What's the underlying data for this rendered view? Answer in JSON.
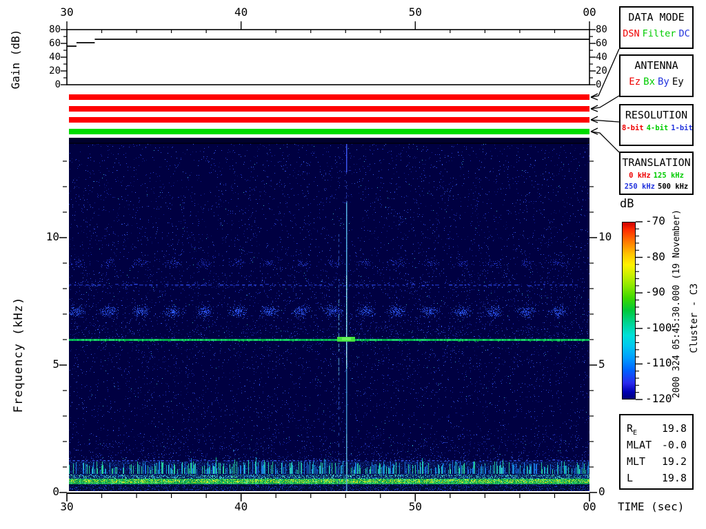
{
  "gain_panel": {
    "ylabel": "Gain (dB)",
    "yticks": [
      {
        "label": "80",
        "v": 80
      },
      {
        "label": "60",
        "v": 60
      },
      {
        "label": "40",
        "v": 40
      },
      {
        "label": "20",
        "v": 20
      },
      {
        "label": "0",
        "v": 0
      }
    ]
  },
  "time_axis": {
    "label": "TIME (sec)",
    "ticks": [
      {
        "label": "30",
        "t": 30
      },
      {
        "label": "40",
        "t": 40
      },
      {
        "label": "50",
        "t": 50
      },
      {
        "label": "00",
        "t": 60
      }
    ]
  },
  "freq_axis": {
    "label": "Frequency (kHz)",
    "ticks": [
      {
        "label": "10",
        "f": 10
      },
      {
        "label": "5",
        "f": 5
      },
      {
        "label": "0",
        "f": 0
      }
    ]
  },
  "status_bars": [
    {
      "name": "data-mode-bar",
      "color": "#ff0000"
    },
    {
      "name": "antenna-bar",
      "color": "#ff0000"
    },
    {
      "name": "resolution-bar",
      "color": "#ff0000"
    },
    {
      "name": "translation-bar",
      "color": "#00dd00"
    }
  ],
  "panels": [
    {
      "title": "DATA MODE",
      "rows": [
        [
          {
            "label": "DSN",
            "color": "#ee0000"
          },
          {
            "label": "Filter",
            "color": "#00cc00"
          },
          {
            "label": "DC",
            "color": "#2233dd"
          }
        ]
      ]
    },
    {
      "title": "ANTENNA",
      "rows": [
        [
          {
            "label": "Ez",
            "color": "#ee0000"
          },
          {
            "label": "Bx",
            "color": "#00cc00"
          },
          {
            "label": "By",
            "color": "#2233dd"
          },
          {
            "label": "Ey",
            "color": "#000000"
          }
        ]
      ]
    },
    {
      "title": "RESOLUTION",
      "rows": [
        [
          {
            "label": "8-bit",
            "color": "#ee0000"
          },
          {
            "label": "4-bit",
            "color": "#00cc00"
          },
          {
            "label": "1-bit",
            "color": "#2233dd"
          }
        ]
      ]
    },
    {
      "title": "TRANSLATION",
      "rows": [
        [
          {
            "label": "0 kHz",
            "color": "#ee0000"
          },
          {
            "label": "125 kHz",
            "color": "#00cc00"
          }
        ],
        [
          {
            "label": "250 kHz",
            "color": "#2233dd"
          },
          {
            "label": "500 kHz",
            "color": "#000000"
          }
        ]
      ]
    }
  ],
  "colorbar": {
    "title": "dB",
    "ticks": [
      {
        "label": "-70",
        "v": -70
      },
      {
        "label": "-80",
        "v": -80
      },
      {
        "label": "-90",
        "v": -90
      },
      {
        "label": "-100",
        "v": -100
      },
      {
        "label": "-110",
        "v": -110
      },
      {
        "label": "-120",
        "v": -120
      }
    ],
    "gradient": [
      "#cc0000 0%",
      "#ff2a00 4%",
      "#ff7a00 11%",
      "#ffc400 18%",
      "#fff200 24%",
      "#c8f000 30%",
      "#8ce800 36%",
      "#3cd800 43%",
      "#00c83c 50%",
      "#00d492 57%",
      "#00e0d8 64%",
      "#00c8f0 70%",
      "#009cff 77%",
      "#0060ff 84%",
      "#2a2aee 91%",
      "#0000b4 96%",
      "#000078 100%"
    ]
  },
  "side_text": {
    "timestamp": "2000 324 05:45:30.000 (19 November)",
    "spacecraft": "Cluster - C3"
  },
  "info_box": {
    "rows": [
      {
        "label": "R",
        "sub": "E",
        "value": "19.8"
      },
      {
        "label": "MLAT",
        "sub": "",
        "value": "-0.0"
      },
      {
        "label": "MLT",
        "sub": "",
        "value": "19.2"
      },
      {
        "label": "L",
        "sub": "",
        "value": "19.8"
      }
    ]
  },
  "chart_data": [
    {
      "type": "line",
      "title": "Receiver gain steps",
      "ylabel": "Gain (dB)",
      "ylim": [
        0,
        80
      ],
      "yticks": [
        0,
        20,
        40,
        60,
        80
      ],
      "x_range_sec": [
        30,
        60
      ],
      "segments": [
        {
          "t": [
            30.0,
            30.55
          ],
          "db": 56
        },
        {
          "t": [
            30.55,
            31.6
          ],
          "db": 61
        },
        {
          "t": [
            31.6,
            60.0
          ],
          "db": 66
        }
      ]
    },
    {
      "type": "heatmap",
      "title": "WBD wideband spectrogram",
      "xlabel": "TIME (sec)",
      "ylabel": "Frequency (kHz)",
      "x_range_sec": [
        30,
        60
      ],
      "x_tick_labels": [
        "30",
        "40",
        "50",
        "00"
      ],
      "y_range_khz": [
        0,
        13.8
      ],
      "colorbar_db": [
        -70,
        -120
      ],
      "background_db": -119,
      "features": [
        {
          "type": "horizontal_line",
          "freq_khz": 6.0,
          "level_db": -95,
          "desc": "continuous narrowband emission across full interval"
        },
        {
          "type": "horizontal_dashed_line",
          "freq_khz": 8.15,
          "level_db": -113,
          "desc": "faint dotted interference line"
        },
        {
          "type": "horizontal_dashed_line",
          "freq_khz": 1.25,
          "level_db": -111,
          "desc": "faint dotted interference line"
        },
        {
          "type": "patch_train",
          "freq_khz": [
            6.4,
            7.8
          ],
          "period_sec": 1.85,
          "start_sec": 30.45,
          "level_db": -115,
          "desc": "periodic diffuse burst patches"
        },
        {
          "type": "patch_train",
          "freq_khz": [
            8.6,
            9.4
          ],
          "period_sec": 1.85,
          "start_sec": 30.45,
          "level_db": -118,
          "desc": "fainter echo of burst patches"
        },
        {
          "type": "vertical_line",
          "time_sec": 46.0,
          "freq_khz": [
            0,
            13.8
          ],
          "level_db": -100,
          "desc": "broadband spike / interference event"
        },
        {
          "type": "vertical_dashed_line",
          "time_sec": 45.55,
          "freq_khz": [
            0,
            10.5
          ],
          "level_db": -110,
          "desc": "weaker companion spike"
        },
        {
          "type": "blob",
          "time_sec": [
            45.6,
            46.6
          ],
          "freq_khz": 6.0,
          "level_db": -88,
          "desc": "brightening of 6 kHz line at spike"
        },
        {
          "type": "band",
          "freq_khz": [
            0.75,
            1.2
          ],
          "level_db": -108,
          "desc": "striated blue band with vertical bursts"
        },
        {
          "type": "band",
          "freq_khz": [
            0.45,
            0.75
          ],
          "level_db": -90,
          "desc": "intense yellow-green low-frequency band"
        },
        {
          "type": "band",
          "freq_khz": [
            0.0,
            0.35
          ],
          "level_db": -116,
          "desc": "dark gap below intense band"
        }
      ]
    }
  ]
}
